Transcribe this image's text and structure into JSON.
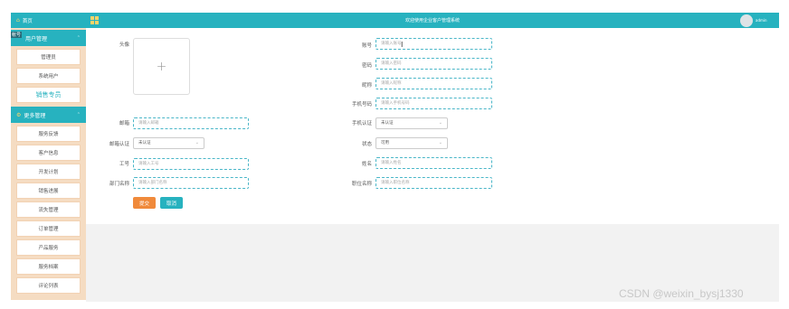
{
  "sidebar": {
    "home": "首页",
    "group1": {
      "mark": "帐号",
      "label": "用户管理",
      "items": [
        "管理员",
        "系统用户",
        "销售专员"
      ]
    },
    "group2": {
      "label": "更多管理",
      "items": [
        "服务反馈",
        "客户信息",
        "开发计划",
        "销售进展",
        "流失管理",
        "订单管理",
        "产品服务",
        "服务档案",
        "评论列表"
      ]
    }
  },
  "header": {
    "title": "欢迎使用企业客户管理系统",
    "user": "admin"
  },
  "form": {
    "avatar_label": "头像",
    "upload_plus": "+",
    "left": [
      {
        "label": "邮箱",
        "placeholder": "请输入邮箱",
        "type": "input"
      },
      {
        "label": "邮箱认证",
        "value": "未认证",
        "type": "select"
      },
      {
        "label": "工号",
        "placeholder": "请输入工号",
        "type": "input"
      },
      {
        "label": "部门名称",
        "placeholder": "请输入部门名称",
        "type": "input"
      }
    ],
    "right": [
      {
        "label": "账号",
        "placeholder": "请输入账号",
        "type": "input"
      },
      {
        "label": "密码",
        "placeholder": "请输入密码",
        "type": "input"
      },
      {
        "label": "昵称",
        "placeholder": "请输入昵称",
        "type": "input"
      },
      {
        "label": "手机号码",
        "placeholder": "请输入手机号码",
        "type": "input"
      },
      {
        "label": "手机认证",
        "value": "未认证",
        "type": "select"
      },
      {
        "label": "状态",
        "value": "可用",
        "type": "select"
      },
      {
        "label": "姓名",
        "placeholder": "请输入姓名",
        "type": "input"
      },
      {
        "label": "职位名称",
        "placeholder": "请输入职位名称",
        "type": "input"
      }
    ],
    "submit": "提交",
    "cancel": "取消"
  },
  "watermark": "CSDN @weixin_bysj1330",
  "colors": {
    "accent": "#27b2bf",
    "sidebar_bg": "#f5dcc2",
    "submit": "#f08a3b"
  }
}
